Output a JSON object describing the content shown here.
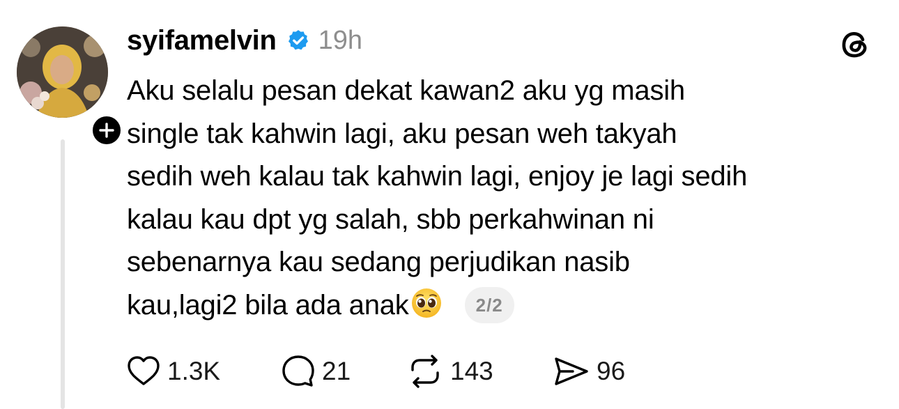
{
  "post": {
    "username": "syifamelvin",
    "timestamp": "19h",
    "verified_icon": "verified-badge-icon",
    "accent_color": "#1d9bf0",
    "body_lines": [
      "Aku selalu pesan dekat kawan2 aku yg masih",
      "single tak kahwin lagi, aku pesan weh takyah",
      "sedih weh kalau tak kahwin lagi, enjoy je lagi sedih",
      "kalau kau dpt yg salah, sbb perkahwinan ni",
      "sebenarnya kau sedang perjudikan nasib",
      "kau,lagi2 bila ada anak"
    ],
    "emoji": "pleading-face",
    "page_indicator": "2/2"
  },
  "actions": {
    "likes": "1.3K",
    "replies": "21",
    "reposts": "143",
    "shares": "96"
  }
}
